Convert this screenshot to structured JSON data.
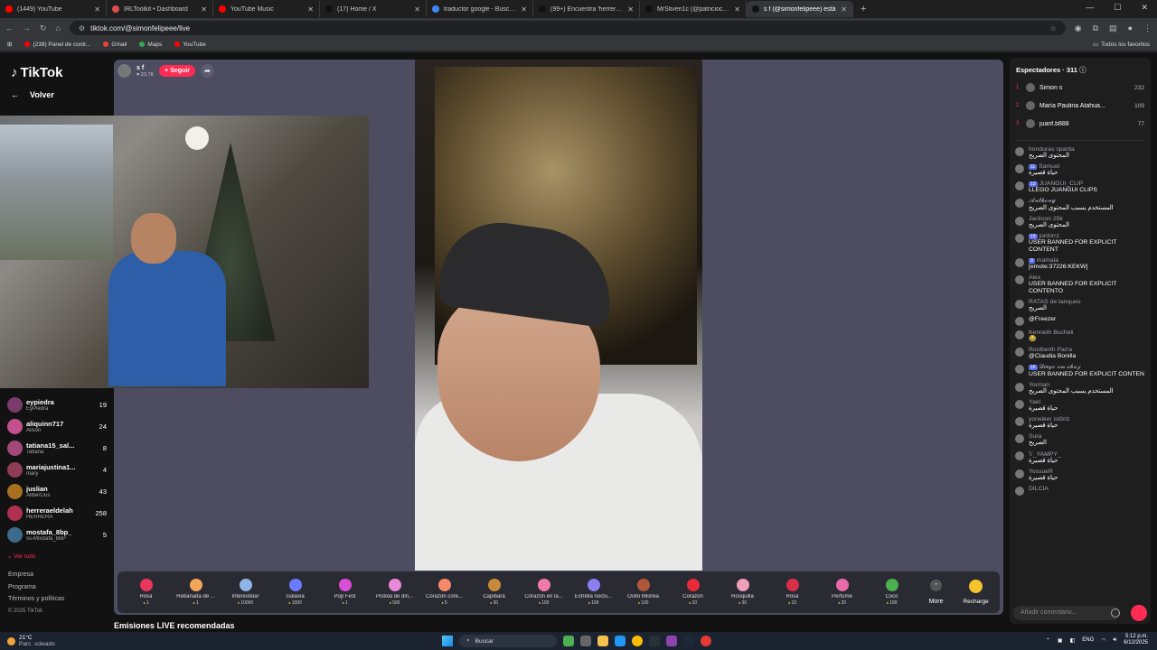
{
  "browser": {
    "tabs": [
      {
        "title": "(1449) YouTube",
        "color": "#ff0000"
      },
      {
        "title": "IRLToolkit • Dashboard",
        "color": "#e04b4b"
      },
      {
        "title": "YouTube Music",
        "color": "#ff0000"
      },
      {
        "title": "(17) Home / X",
        "color": "#111111"
      },
      {
        "title": "traductor google - Buscar con G",
        "color": "#4285f4"
      },
      {
        "title": "(99+) Encuentra 'herrera' en Tik",
        "color": "#111111"
      },
      {
        "title": "MrStiven1c (@patricioclips_) en",
        "color": "#111111"
      },
      {
        "title": "s f (@simonfelipeee) está",
        "color": "#111111"
      }
    ],
    "new_tab": "+",
    "url": "tiktok.com/@simonfelipeee/live",
    "bookmarks": [
      {
        "label": "(238) Panel de contr...",
        "color": "#ff0000"
      },
      {
        "label": "Gmail",
        "color": "#ea4335"
      },
      {
        "label": "Maps",
        "color": "#34a853"
      },
      {
        "label": "YouTube",
        "color": "#ff0000"
      }
    ],
    "all_favorites": "Todos los favoritos"
  },
  "tiktok": {
    "logo": "TikTok",
    "back_label": "Volver",
    "viewers": [
      {
        "name": "eypiedra",
        "sub": "EyPiedra",
        "count": "19"
      },
      {
        "name": "aliquinn717",
        "sub": "Alison",
        "count": "24"
      },
      {
        "name": "tatiana15_sal...",
        "sub": "Tatiana",
        "count": "8"
      },
      {
        "name": "mariajustina1...",
        "sub": "mary",
        "count": "4"
      },
      {
        "name": "juslian",
        "sub": "AllbertJus",
        "count": "43"
      },
      {
        "name": "herreraeldelah",
        "sub": "HERRERA",
        "count": "258"
      },
      {
        "name": "mostafa_8bp_",
        "sub": "ss-Mostafa_8BP",
        "count": "5"
      }
    ],
    "ver_todo": "Ver todo",
    "footer": [
      "Empresa",
      "Programa",
      "Términos y políticas"
    ],
    "copyright": "© 2025 TikTok",
    "host": {
      "name": "s f",
      "likes": "23.7K",
      "follow_label": "+ Seguir"
    },
    "gifts": [
      {
        "name": "Rosa",
        "price": "1",
        "color": "#e8365d"
      },
      {
        "name": "Rebanada de ...",
        "price": "1",
        "color": "#f2a65a"
      },
      {
        "name": "Interestelar",
        "price": "10000",
        "color": "#8fb4e8"
      },
      {
        "name": "Galaxia",
        "price": "1000",
        "color": "#6a7bff"
      },
      {
        "name": "Pop Fest",
        "price": "1",
        "color": "#d94fd9"
      },
      {
        "name": "Pistola de din...",
        "price": "500",
        "color": "#e88ad9"
      },
      {
        "name": "Corazón core...",
        "price": "5",
        "color": "#f58a6a"
      },
      {
        "name": "Capibara",
        "price": "30",
        "color": "#c88a3a"
      },
      {
        "name": "Corazón en la...",
        "price": "100",
        "color": "#f07aa8"
      },
      {
        "name": "Estrella noctu...",
        "price": "199",
        "color": "#8a7ff0"
      },
      {
        "name": "Osito Mishka",
        "price": "100",
        "color": "#b0573a"
      },
      {
        "name": "Corazón",
        "price": "10",
        "color": "#e82a3a"
      },
      {
        "name": "Rosquilla",
        "price": "30",
        "color": "#f0a0b8"
      },
      {
        "name": "Rosa",
        "price": "10",
        "color": "#d9304a"
      },
      {
        "name": "Perfume",
        "price": "20",
        "color": "#e86aa8"
      },
      {
        "name": "Coco",
        "price": "199",
        "color": "#4caf50"
      }
    ],
    "more_label": "More",
    "recharge_label": "Recharge",
    "recommended": "Emisiones LIVE recomendadas",
    "chat": {
      "header": "Espectadores · 311",
      "top_viewers": [
        {
          "rank": "1",
          "name": "Simon s",
          "count": "232"
        },
        {
          "rank": "2",
          "name": "María Paulina Atahua...",
          "count": "109"
        },
        {
          "rank": "3",
          "name": "juanf.b888",
          "count": "77"
        }
      ],
      "messages": [
        {
          "user": "honduras spanta",
          "badge": "",
          "text": "المحتوى الصريح"
        },
        {
          "user": "Samuel",
          "badge": "11",
          "text": "حياة قصيرة"
        },
        {
          "user": "JUANGUI_CLIP",
          "badge": "13",
          "text": "LLEGO JUANGUI CLIPS"
        },
        {
          "user": "𝓐𝓷𝓽𝓱𝓸𝓷𝔂",
          "badge": "",
          "text": "المستخدم يسبب المحتوى الصريح"
        },
        {
          "user": "Jackson 25k",
          "badge": "",
          "text": "المحتوى الصريح"
        },
        {
          "user": "juniorrz",
          "badge": "19",
          "text": "USER BANNED FOR EXPLICIT CONTENT"
        },
        {
          "user": "mamala",
          "badge": "9",
          "text": "[emote:37226:KEKW]"
        },
        {
          "user": "Alex",
          "badge": "",
          "text": "USER BANNED FOR EXPLICIT CONTENTO"
        },
        {
          "user": "RATAS de tanqueo",
          "badge": "",
          "text": "الصريح"
        },
        {
          "user": "",
          "badge": "",
          "text": "@Freezer"
        },
        {
          "user": "Kenneth Bucheli",
          "badge": "",
          "text": "😂"
        },
        {
          "user": "Roolberth Parra",
          "badge": "",
          "text": "@Claudia Bonilla"
        },
        {
          "user": "𝓓𝓲𝓮𝓰𝓸 𝓻𝓶 𝓬𝓱𝓪𝓳",
          "badge": "16",
          "text": "USER BANNED FOR EXPLICIT CONTEN"
        },
        {
          "user": "Yorman",
          "badge": "",
          "text": "المستخدم يسبب المحتوى الصريح"
        },
        {
          "user": "Yael",
          "badge": "",
          "text": "حياة قصيرة"
        },
        {
          "user": "yoneiker istöriz",
          "badge": "",
          "text": "حياة قصيرة"
        },
        {
          "user": "Sura",
          "badge": "",
          "text": "الصريح"
        },
        {
          "user": "𝕐_YAMPY_",
          "badge": "",
          "text": "حياة قصيرة"
        },
        {
          "user": "YossueR",
          "badge": "",
          "text": "حياة قصيرة"
        },
        {
          "user": "DILCIA",
          "badge": "",
          "text": ""
        }
      ],
      "input_placeholder": "Añadir comentario..."
    }
  },
  "taskbar": {
    "temp": "21°C",
    "weather": "Parc. soleado",
    "search": "Buscar",
    "lang": "ENG",
    "time": "5:12 p.m.",
    "date": "6/12/2025"
  }
}
